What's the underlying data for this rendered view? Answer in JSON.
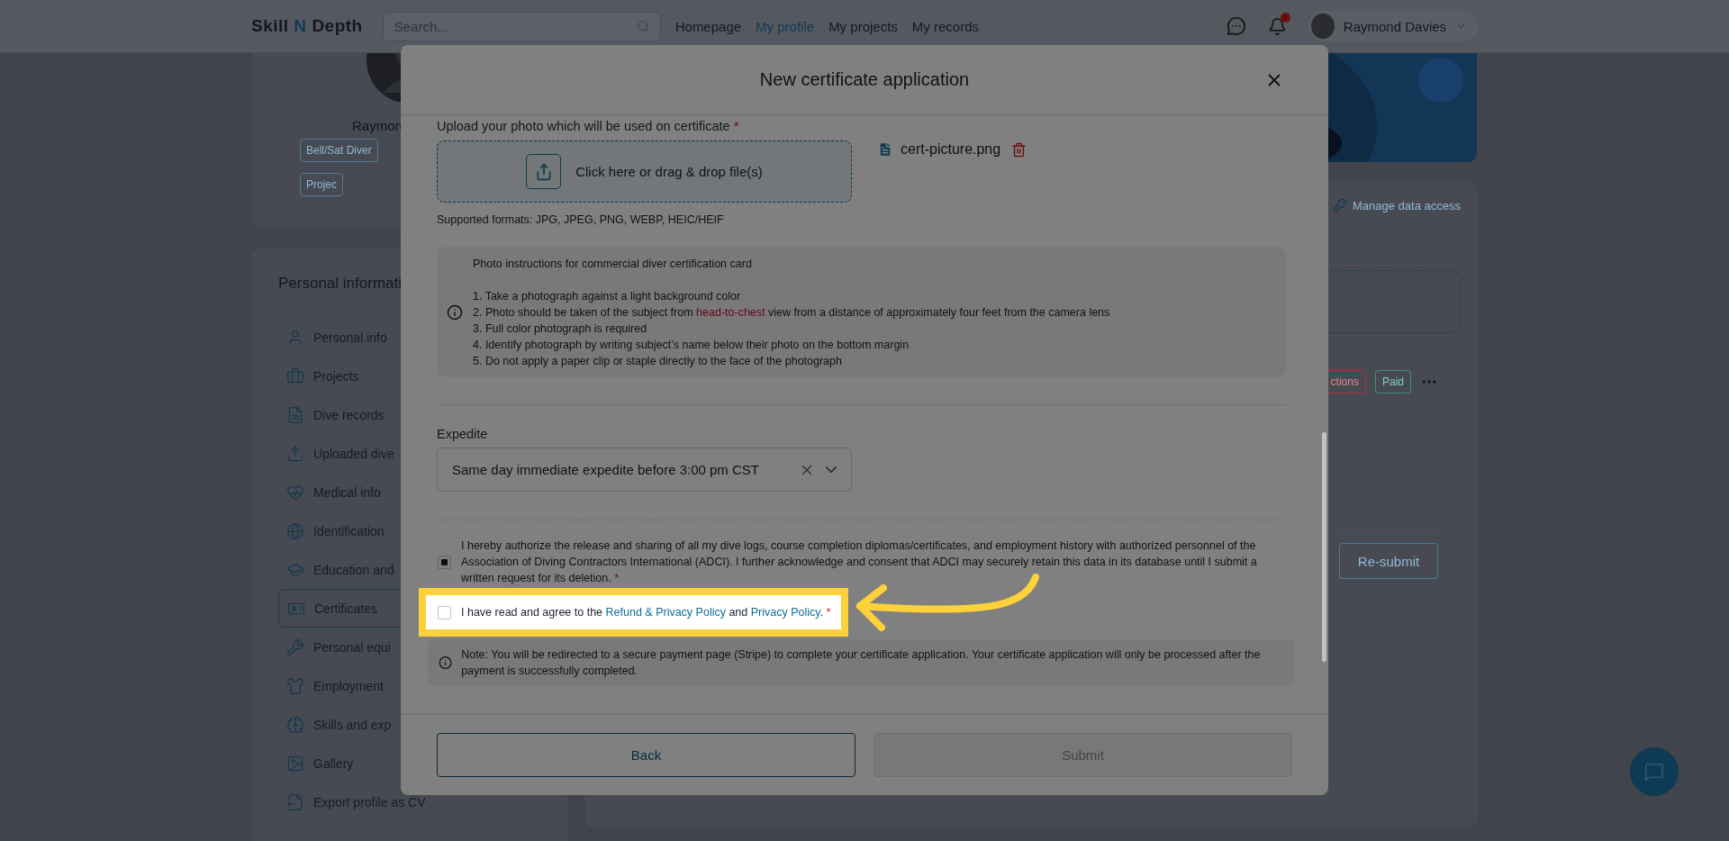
{
  "nav": {
    "logo_start": "Skill",
    "logo_accent": "N",
    "logo_end": "Depth",
    "search": {
      "placeholder": "Search..."
    },
    "links": [
      {
        "label": "Homepage",
        "selected": false
      },
      {
        "label": "My profile",
        "selected": true
      },
      {
        "label": "My projects",
        "selected": false
      },
      {
        "label": "My records",
        "selected": false
      }
    ],
    "notification_count": "2",
    "user": "Raymond Davies"
  },
  "profile": {
    "name": "Raymon",
    "tags": [
      "Bell/Sat Diver",
      "Projec"
    ]
  },
  "sidebar": {
    "title": "Personal informati",
    "items": [
      {
        "label": "Personal info",
        "selected": false
      },
      {
        "label": "Projects",
        "selected": false
      },
      {
        "label": "Dive records",
        "selected": false
      },
      {
        "label": "Uploaded dive",
        "selected": false
      },
      {
        "label": "Medical info",
        "selected": false
      },
      {
        "label": "Identification",
        "selected": false
      },
      {
        "label": "Education and",
        "selected": false
      },
      {
        "label": "Certificates",
        "selected": true
      },
      {
        "label": "Personal equi",
        "selected": false
      },
      {
        "label": "Employment",
        "selected": false
      },
      {
        "label": "Skills and exp",
        "selected": false
      },
      {
        "label": "Gallery",
        "selected": false
      },
      {
        "label": "Export profile as CV",
        "selected": false
      }
    ]
  },
  "certificate_panel": {
    "manage_link": "Manage data access",
    "tags": [
      {
        "label": "ctions",
        "kind": "danger"
      },
      {
        "label": "Paid",
        "kind": "success"
      }
    ],
    "resubmit": "Re-submit"
  },
  "modal": {
    "title": "New certificate application",
    "upload": {
      "label": "Upload your photo which will be used on certificate",
      "required": "*",
      "dropzone": "Click here or drag & drop file(s)",
      "file": "cert-picture.png",
      "formats": "Supported formats: JPG, JPEG, PNG, WEBP, HEIC/HEIF"
    },
    "instructions": {
      "title": "Photo instructions for commercial diver certification card",
      "items": [
        [
          {
            "text": "1. Take a photograph against a light background color",
            "emphasis": false
          }
        ],
        [
          {
            "text": "2. Photo should be taken of the subject from ",
            "emphasis": false
          },
          {
            "text": "head-to-chest",
            "emphasis": true
          },
          {
            "text": " view from a distance of approximately four feet from the camera lens",
            "emphasis": false
          }
        ],
        [
          {
            "text": "3. Full color photograph is required",
            "emphasis": false
          }
        ],
        [
          {
            "text": "4. Identify photograph by writing subject’s name below their photo on the bottom margin",
            "emphasis": false
          }
        ],
        [
          {
            "text": "5. Do not apply a paper clip or staple directly to the face of the photograph",
            "emphasis": false
          }
        ]
      ]
    },
    "expedite": {
      "label": "Expedite",
      "value": "Same day immediate expedite before 3:00 pm CST"
    },
    "consents": [
      {
        "checked": true,
        "highlighted": false,
        "required": "*",
        "parts": [
          {
            "text": "I hereby authorize the release and sharing of all my dive logs, course completion diplomas/certificates, and employment history with authorized personnel of the Association of Diving Contractors International (ADCI). I further acknowledge and consent that ADCI may securely retain this data in its database until I submit a written request for its deletion.",
            "link": false
          }
        ]
      },
      {
        "checked": false,
        "highlighted": true,
        "required": "*",
        "parts": [
          {
            "text": "I have read and agree to the ",
            "link": false
          },
          {
            "text": "Refund & Privacy Policy",
            "link": true
          },
          {
            "text": " and ",
            "link": false
          },
          {
            "text": "Privacy Policy",
            "link": true
          },
          {
            "text": ".",
            "link": false
          }
        ]
      }
    ],
    "note": "Note: You will be redirected to a secure payment page (Stripe) to complete your certificate application. Your certificate application will only be processed after the payment is successfully completed.",
    "buttons": [
      {
        "label": "Back",
        "disabled": false
      },
      {
        "label": "Submit",
        "disabled": true
      }
    ]
  }
}
